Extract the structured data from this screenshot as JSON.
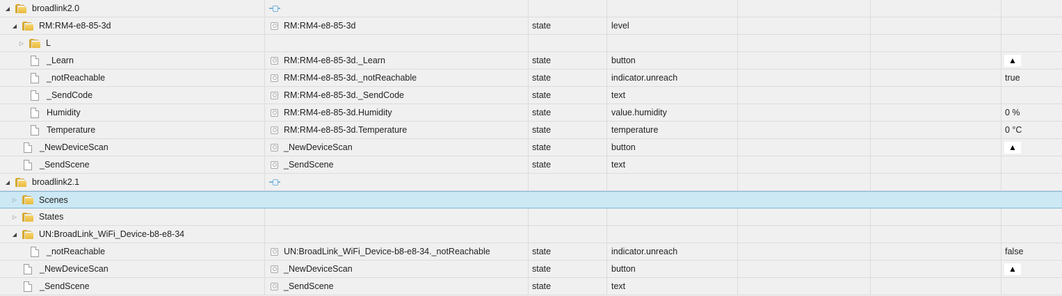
{
  "rows": [
    {
      "name": "broadlink2.0",
      "type": "folder",
      "expanded": true,
      "adapter_icon": true
    },
    {
      "name": "RM:RM4-e8-85-3d",
      "type": "folder",
      "expanded": true,
      "id": "RM:RM4-e8-85-3d",
      "kind": "state",
      "role": "level"
    },
    {
      "name": "L",
      "type": "folder",
      "expanded": false
    },
    {
      "name": "_Learn",
      "type": "file",
      "id": "RM:RM4-e8-85-3d._Learn",
      "kind": "state",
      "role": "button",
      "value_button": "▲"
    },
    {
      "name": "_notReachable",
      "type": "file",
      "id": "RM:RM4-e8-85-3d._notReachable",
      "kind": "state",
      "role": "indicator.unreach",
      "value": "true"
    },
    {
      "name": "_SendCode",
      "type": "file",
      "id": "RM:RM4-e8-85-3d._SendCode",
      "kind": "state",
      "role": "text"
    },
    {
      "name": "Humidity",
      "type": "file",
      "id": "RM:RM4-e8-85-3d.Humidity",
      "kind": "state",
      "role": "value.humidity",
      "value": "0 %"
    },
    {
      "name": "Temperature",
      "type": "file",
      "id": "RM:RM4-e8-85-3d.Temperature",
      "kind": "state",
      "role": "temperature",
      "value": "0 °C"
    },
    {
      "name": "_NewDeviceScan",
      "type": "file",
      "id": "_NewDeviceScan",
      "kind": "state",
      "role": "button",
      "value_button": "▲"
    },
    {
      "name": "_SendScene",
      "type": "file",
      "id": "_SendScene",
      "kind": "state",
      "role": "text"
    },
    {
      "name": "broadlink2.1",
      "type": "folder",
      "expanded": true,
      "adapter_icon": true
    },
    {
      "name": "Scenes",
      "type": "folder",
      "expanded": false,
      "selected": true
    },
    {
      "name": "States",
      "type": "folder",
      "expanded": false
    },
    {
      "name": "UN:BroadLink_WiFi_Device-b8-e8-34",
      "type": "folder",
      "expanded": true
    },
    {
      "name": "_notReachable",
      "type": "file",
      "id": "UN:BroadLink_WiFi_Device-b8-e8-34._notReachable",
      "kind": "state",
      "role": "indicator.unreach",
      "value": "false"
    },
    {
      "name": "_NewDeviceScan",
      "type": "file",
      "id": "_NewDeviceScan",
      "kind": "state",
      "role": "button",
      "value_button": "▲"
    },
    {
      "name": "_SendScene",
      "type": "file",
      "id": "_SendScene",
      "kind": "state",
      "role": "text"
    }
  ],
  "icons": {
    "expanded": "◢",
    "collapsed": "▷",
    "folder": "folder-icon",
    "file": "file-icon",
    "state": "state-icon",
    "button": "triangle-up-icon"
  },
  "colors": {
    "selected_row": "#cce8f4",
    "folder": "#e9b93c",
    "grid": "#dcdcdc"
  }
}
